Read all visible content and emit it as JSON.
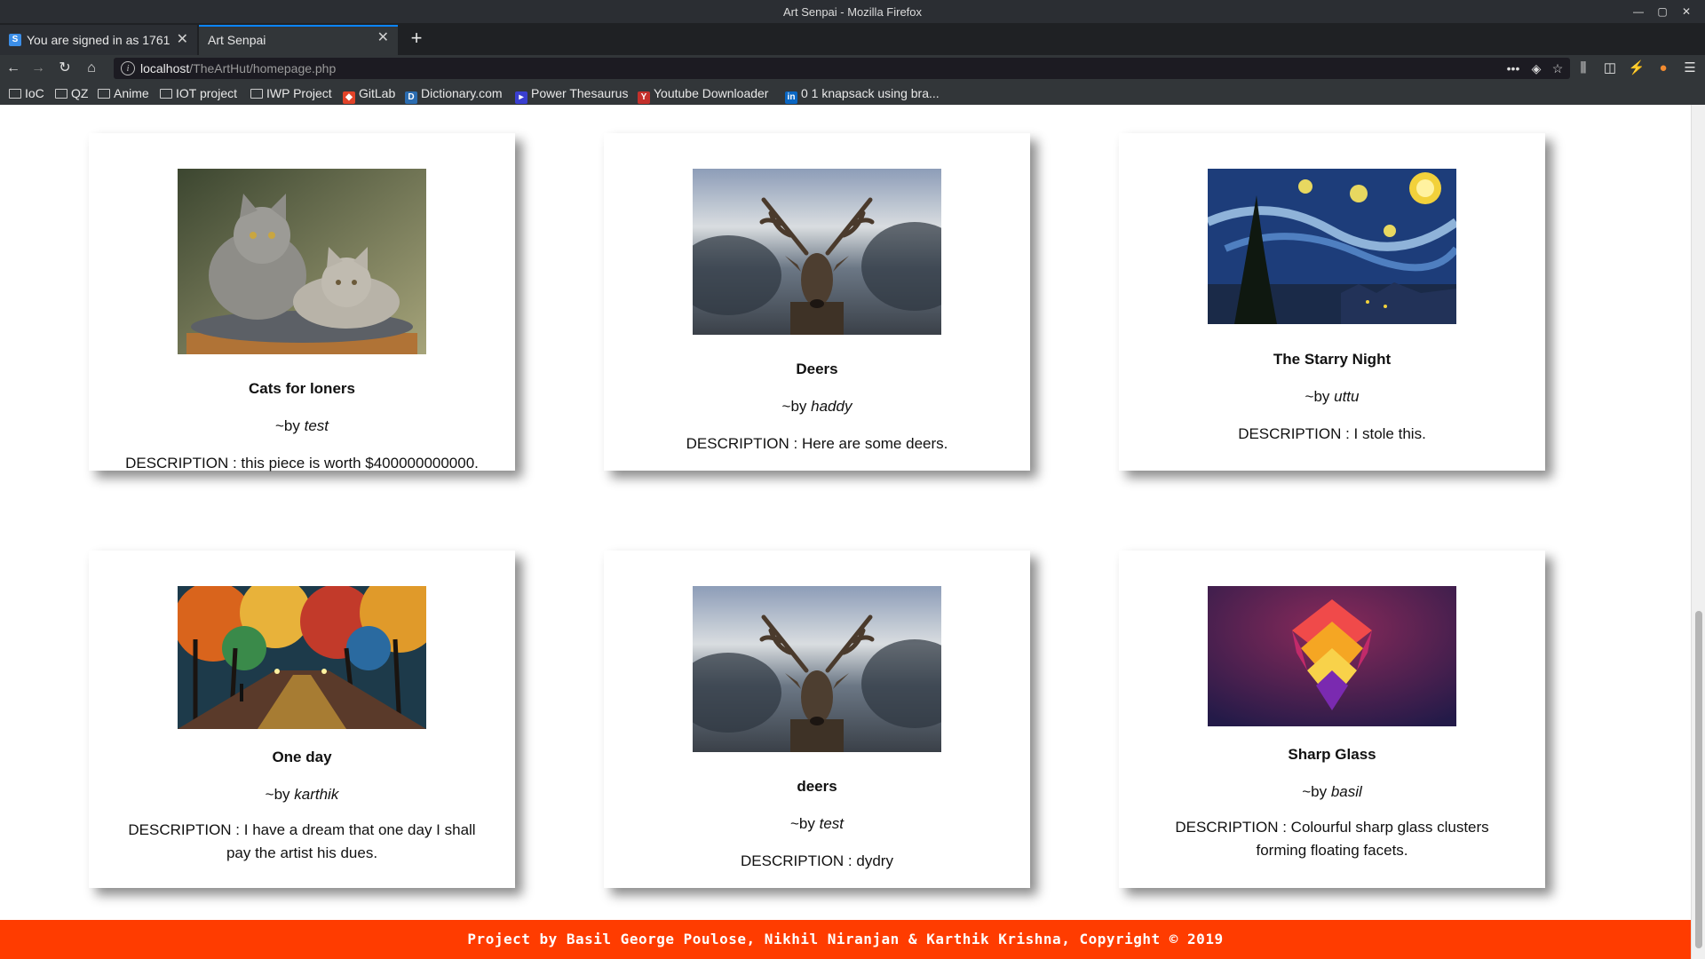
{
  "window": {
    "title": "Art Senpai - Mozilla Firefox"
  },
  "tabs": [
    {
      "label": "You are signed in as 1761",
      "favicon": "S"
    },
    {
      "label": "Art Senpai"
    }
  ],
  "address": {
    "host": "localhost",
    "path": "/TheArtHut/homepage.php"
  },
  "bookmarks": [
    {
      "label": "IoC",
      "icon": "folder-icon"
    },
    {
      "label": "QZ",
      "icon": "folder-icon"
    },
    {
      "label": "Anime",
      "icon": "folder-icon"
    },
    {
      "label": "IOT project",
      "icon": "folder-icon"
    },
    {
      "label": "IWP Project",
      "icon": "folder-icon"
    },
    {
      "label": "GitLab",
      "icon": "gitlab-icon"
    },
    {
      "label": "Dictionary.com",
      "icon": "dictionary-icon"
    },
    {
      "label": "Power Thesaurus",
      "icon": "thesaurus-icon"
    },
    {
      "label": "Youtube Downloader",
      "icon": "youtube-icon"
    },
    {
      "label": "0 1 knapsack using bra...",
      "icon": "linkedin-icon"
    }
  ],
  "cards": [
    {
      "title": "Cats for loners",
      "by_prefix": "~by ",
      "author": "test",
      "description": "DESCRIPTION : this piece is worth $400000000000.",
      "image": "cats-artwork"
    },
    {
      "title": "Deers",
      "by_prefix": "~by ",
      "author": "haddy",
      "description": "DESCRIPTION : Here are some deers.",
      "image": "deer-artwork"
    },
    {
      "title": "The Starry Night",
      "by_prefix": "~by ",
      "author": "uttu",
      "description": "DESCRIPTION : I stole this.",
      "image": "starry-night-artwork"
    },
    {
      "title": "One day",
      "by_prefix": "~by ",
      "author": "karthik",
      "description": "DESCRIPTION : I have a dream that one day I shall pay the artist his dues.",
      "image": "autumn-alley-artwork"
    },
    {
      "title": "deers",
      "by_prefix": "~by ",
      "author": "test",
      "description": "DESCRIPTION : dydry",
      "image": "deer-artwork"
    },
    {
      "title": "Sharp Glass",
      "by_prefix": "~by ",
      "author": "basil",
      "description": "DESCRIPTION : Colourful sharp glass clusters forming floating facets.",
      "image": "sharp-glass-artwork"
    }
  ],
  "footer": {
    "text": "Project by Basil George Poulose, Nikhil Niranjan & Karthik Krishna, Copyright © 2019"
  },
  "colors": {
    "footer_bg": "#ff3c00",
    "tab_accent": "#0a84ff",
    "chrome_dark": "#1f2124"
  }
}
